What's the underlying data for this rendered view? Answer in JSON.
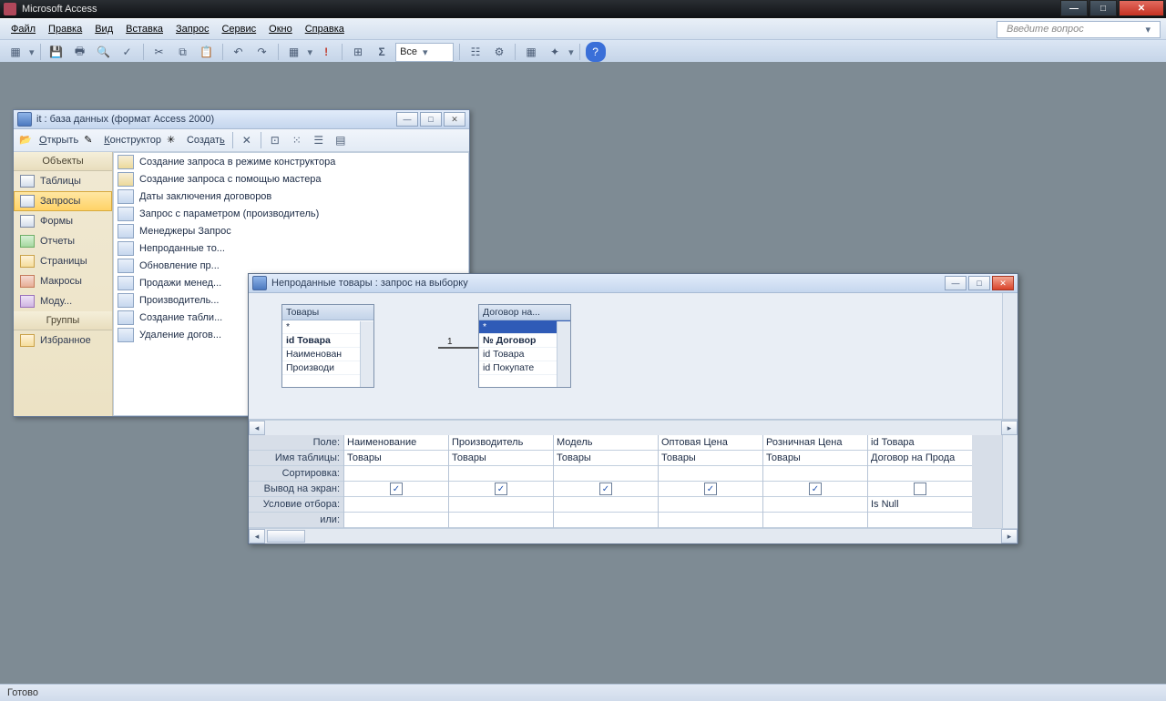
{
  "app": {
    "title": "Microsoft Access"
  },
  "menu": {
    "items": [
      "Файл",
      "Правка",
      "Вид",
      "Вставка",
      "Запрос",
      "Сервис",
      "Окно",
      "Справка"
    ],
    "ask_placeholder": "Введите вопрос"
  },
  "toolbar_combo": "Все",
  "status": "Готово",
  "dbwin": {
    "title": "it : база данных (формат Access 2000)",
    "toolbar": {
      "open": "Открыть",
      "design": "Конструктор",
      "create": "Создать"
    },
    "side_header": "Объекты",
    "groups_header": "Группы",
    "nav": [
      {
        "label": "Таблицы"
      },
      {
        "label": "Запросы",
        "selected": true
      },
      {
        "label": "Формы"
      },
      {
        "label": "Отчеты"
      },
      {
        "label": "Страницы"
      },
      {
        "label": "Макросы"
      },
      {
        "label": "Моду..."
      }
    ],
    "fav": "Избранное",
    "list": [
      "Создание запроса в режиме конструктора",
      "Создание запроса с помощью мастера",
      "Даты заключения договоров",
      "Запрос с параметром (производитель)",
      "Менеджеры Запрос",
      "Непроданные то...",
      "Обновление пр...",
      "Продажи менед...",
      "Производитель...",
      "Создание табли...",
      "Удаление догов..."
    ]
  },
  "qwin": {
    "title": "Непроданные товары : запрос на выборку",
    "rel": {
      "one": "1",
      "many": "∞"
    },
    "tables": {
      "t1": {
        "title": "Товары",
        "rows": [
          "*",
          "id Товара",
          "Наименован",
          "Производи"
        ]
      },
      "t2": {
        "title": "Договор на...",
        "rows": [
          "*",
          "№ Договор",
          "id Товара",
          "id Покупате"
        ]
      }
    },
    "row_labels": [
      "Поле:",
      "Имя таблицы:",
      "Сортировка:",
      "Вывод на экран:",
      "Условие отбора:",
      "или:"
    ],
    "grid": [
      {
        "field": "Наименование",
        "table": "Товары",
        "show": true,
        "criteria": ""
      },
      {
        "field": "Производитель",
        "table": "Товары",
        "show": true,
        "criteria": ""
      },
      {
        "field": "Модель",
        "table": "Товары",
        "show": true,
        "criteria": ""
      },
      {
        "field": "Оптовая Цена",
        "table": "Товары",
        "show": true,
        "criteria": ""
      },
      {
        "field": "Розничная Цена",
        "table": "Товары",
        "show": true,
        "criteria": ""
      },
      {
        "field": "id Товара",
        "table": "Договор на Прода",
        "show": false,
        "criteria": "Is Null"
      }
    ]
  }
}
